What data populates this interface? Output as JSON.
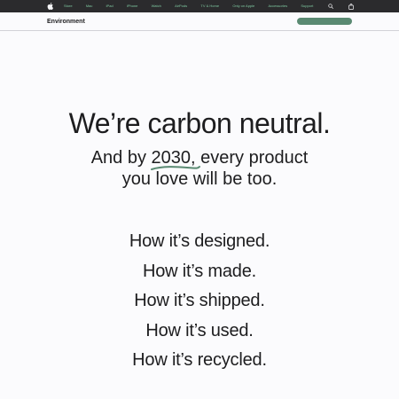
{
  "nav": {
    "items": [
      "Store",
      "Mac",
      "iPad",
      "iPhone",
      "Watch",
      "AirPods",
      "TV & Home",
      "Only on Apple",
      "Accessories",
      "Support"
    ]
  },
  "subnav": {
    "title": "Environment"
  },
  "hero": {
    "title": "We’re carbon neutral.",
    "sub_prefix": "And by ",
    "sub_year": "2030",
    "sub_rest": ", every product",
    "sub_line2": "you love will be too."
  },
  "lifecycle": [
    "How it’s designed.",
    "How it’s made.",
    "How it’s shipped.",
    "How it’s used.",
    "How it’s recycled."
  ],
  "colors": {
    "nav_bg": "#2b2b2d",
    "nav_text": "#7fc8a0",
    "accent_green": "#5a8a72"
  }
}
